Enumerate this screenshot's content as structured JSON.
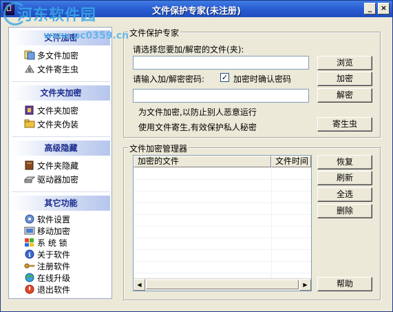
{
  "window": {
    "title": "文件保护专家(未注册)",
    "watermark": "河东软件园",
    "watermark_url": "www.pc0359.cn",
    "minimize_glyph": "_",
    "close_glyph": "×"
  },
  "sidebar": {
    "sections": [
      {
        "title": "文件加密",
        "items": [
          {
            "label": "多文件加密",
            "icon": "multi-file-encrypt-icon"
          },
          {
            "label": "文件寄生虫",
            "icon": "file-parasite-icon"
          }
        ]
      },
      {
        "title": "文件夹加密",
        "items": [
          {
            "label": "文件夹加密",
            "icon": "folder-encrypt-icon"
          },
          {
            "label": "文件夹伪装",
            "icon": "folder-disguise-icon"
          }
        ]
      },
      {
        "title": "高级隐藏",
        "items": [
          {
            "label": "文件夹隐藏",
            "icon": "folder-hide-icon"
          },
          {
            "label": "驱动器加密",
            "icon": "drive-encrypt-icon"
          }
        ]
      },
      {
        "title": "其它功能",
        "items": [
          {
            "label": "软件设置",
            "icon": "settings-icon"
          },
          {
            "label": "移动加密",
            "icon": "mobile-encrypt-icon"
          },
          {
            "label": "系 统 锁",
            "icon": "system-lock-icon"
          },
          {
            "label": "关于软件",
            "icon": "info-icon"
          },
          {
            "label": "注册软件",
            "icon": "register-key-icon"
          },
          {
            "label": "在线升级",
            "icon": "online-update-icon"
          },
          {
            "label": "退出软件",
            "icon": "exit-icon"
          }
        ]
      }
    ]
  },
  "protect": {
    "group_title": "文件保护专家",
    "select_label": "请选择您要加/解密的文件(夹):",
    "file_value": "",
    "browse_button": "浏览",
    "password_label": "请输入加/解密密码:",
    "confirm_checkbox_label": "加密时确认密码",
    "confirm_checked": true,
    "password_value": "",
    "encrypt_button": "加密",
    "decrypt_button": "解密",
    "info_line1": "为文件加密,以防止别人恶意运行",
    "info_line2": "使用文件寄生,有效保护私人秘密",
    "parasite_button": "寄生虫"
  },
  "manager": {
    "group_title": "文件加密管理器",
    "columns": [
      "加密的文件",
      "文件时间"
    ],
    "rows": [],
    "restore_button": "恢复",
    "refresh_button": "刷新",
    "select_all_button": "全选",
    "delete_button": "删除",
    "help_button": "帮助"
  },
  "colors": {
    "titlebar": "#2b5fd3",
    "section_title_text": "#1a2b8e",
    "window_bg": "#ece9d8"
  }
}
